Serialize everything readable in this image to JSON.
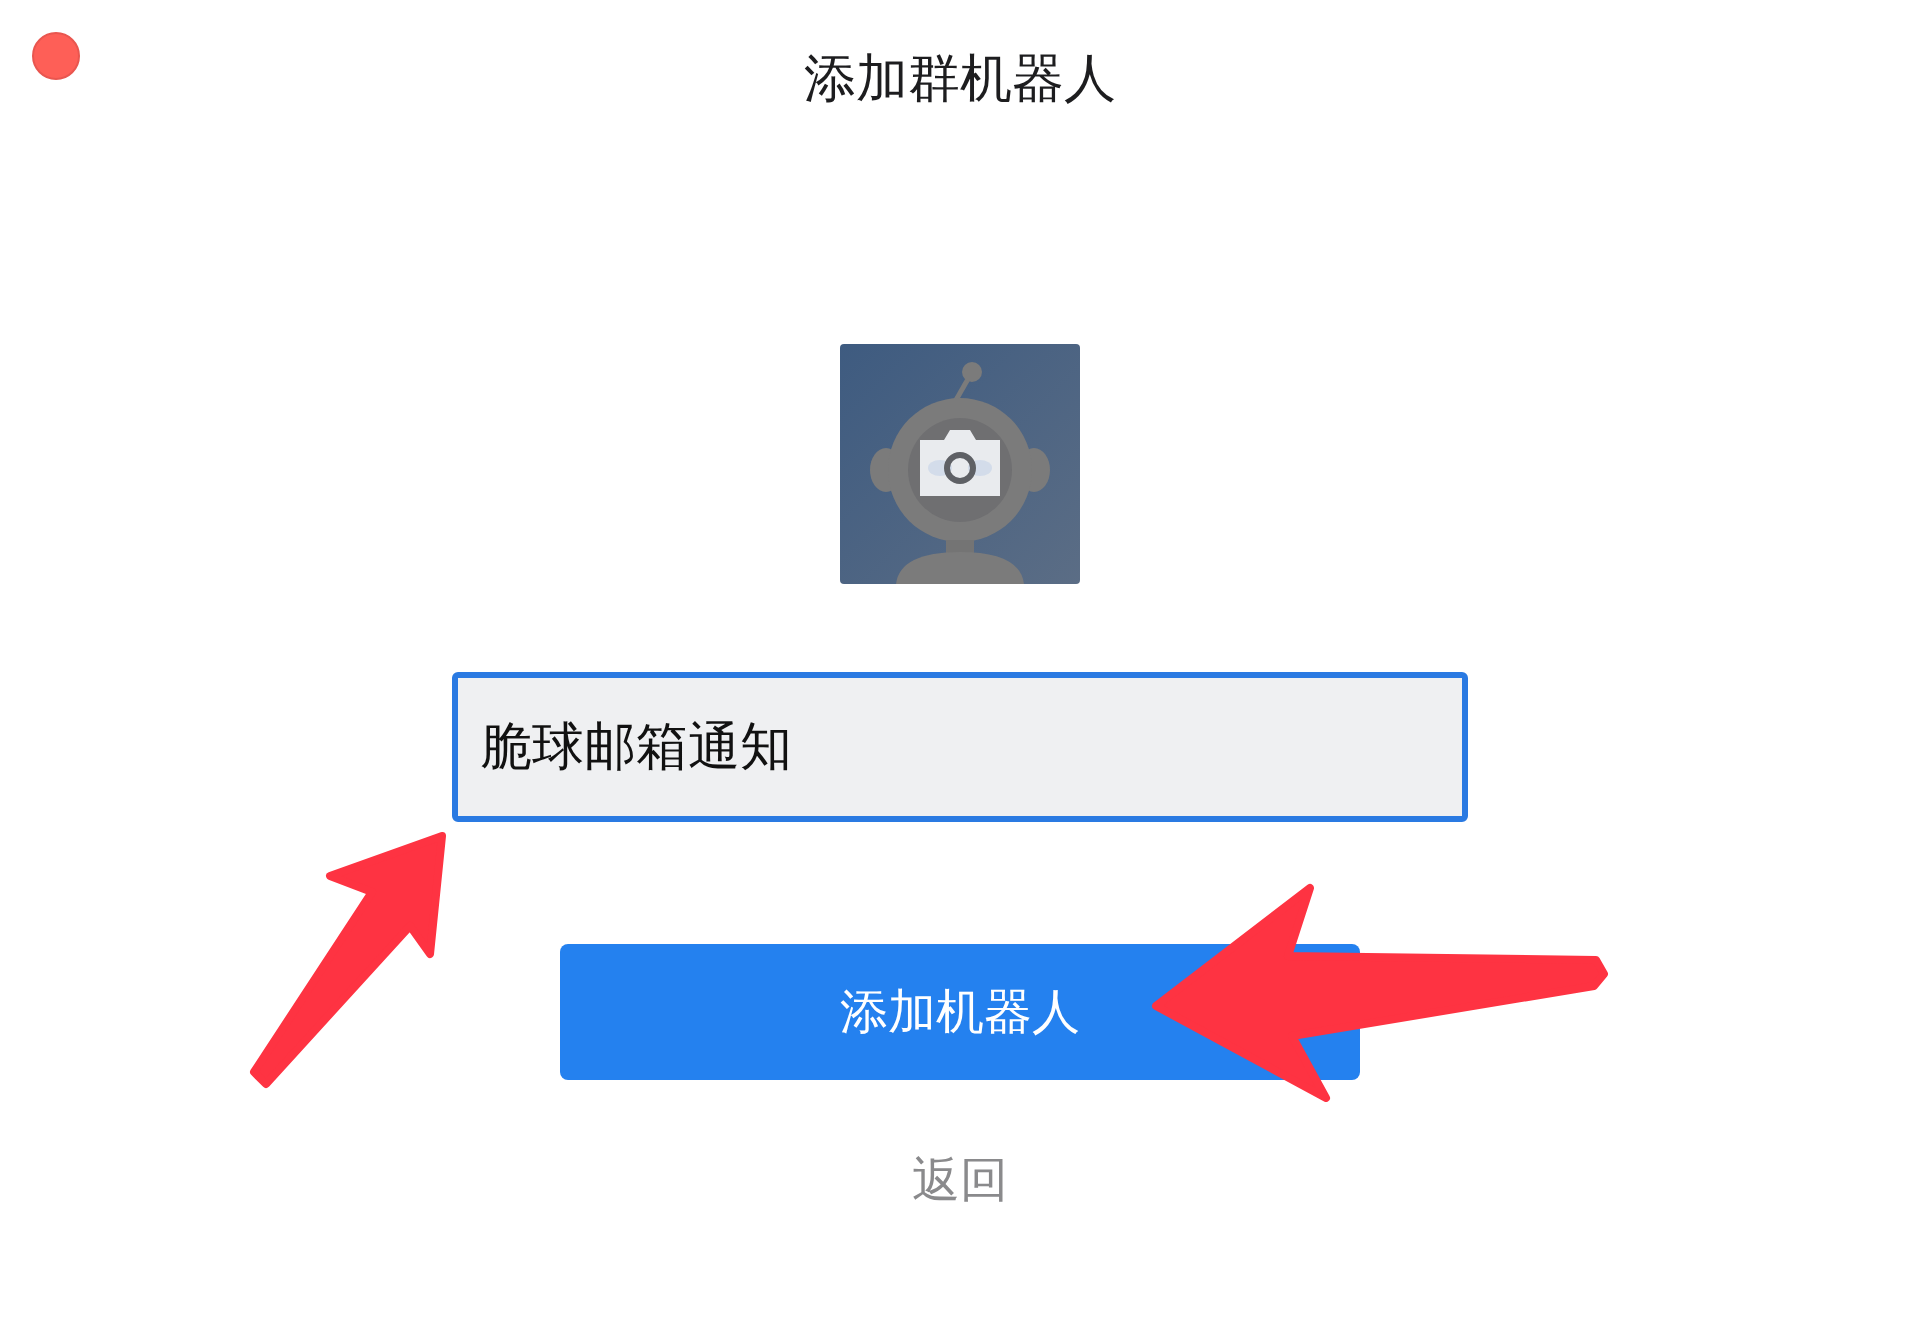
{
  "window": {
    "title": "添加群机器人"
  },
  "form": {
    "name_field": {
      "value": "脆球邮箱通知",
      "focused": true
    },
    "submit_button": {
      "label": "添加机器人"
    },
    "back_link": {
      "label": "返回"
    }
  }
}
